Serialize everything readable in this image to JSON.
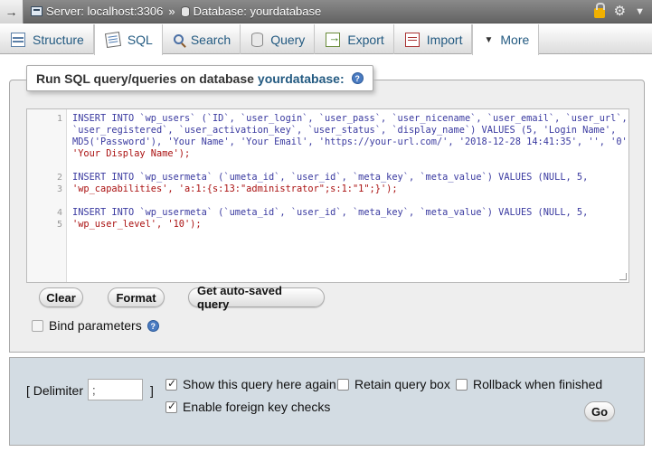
{
  "topbar": {
    "collapse_glyph": "→",
    "server_label": "Server: localhost:3306",
    "separator": "»",
    "database_label": "Database: yourdatabase"
  },
  "tabs": [
    {
      "label": "Structure",
      "icon": "structure-icon"
    },
    {
      "label": "SQL",
      "icon": "sql-icon",
      "active": true
    },
    {
      "label": "Search",
      "icon": "search-icon"
    },
    {
      "label": "Query",
      "icon": "query-icon"
    },
    {
      "label": "Export",
      "icon": "export-icon"
    },
    {
      "label": "Import",
      "icon": "import-icon"
    },
    {
      "label": "More",
      "icon": "caret-down-icon"
    }
  ],
  "legend": {
    "prefix": "Run SQL query/queries on database",
    "database": "yourdatabase:"
  },
  "editor": {
    "line_numbers": [
      "1",
      "2",
      "3",
      "4",
      "5"
    ],
    "lines": [
      "INSERT INTO `wp_users` (`ID`, `user_login`, `user_pass`, `user_nicename`, `user_email`, `user_url`,",
      "`user_registered`, `user_activation_key`, `user_status`, `display_name`) VALUES (5, 'Login Name',",
      "MD5('Password'), 'Your Name', 'Your Email', 'https://your-url.com/', '2018-12-28 14:41:35', '', '0',",
      "'Your Display Name');",
      "INSERT INTO `wp_usermeta` (`umeta_id`, `user_id`, `meta_key`, `meta_value`) VALUES (NULL, 5,",
      "'wp_capabilities', 'a:1:{s:13:\"administrator\";s:1:\"1\";}');",
      "INSERT INTO `wp_usermeta` (`umeta_id`, `user_id`, `meta_key`, `meta_value`) VALUES (NULL, 5,",
      "'wp_user_level', '10');"
    ]
  },
  "buttons": {
    "clear": "Clear",
    "format": "Format",
    "get_autosaved": "Get auto-saved query",
    "go": "Go"
  },
  "options": {
    "bind_parameters": "Bind parameters",
    "delimiter_open": "[ Delimiter",
    "delimiter_value": ";",
    "delimiter_close": "]",
    "show_query_again": "Show this query here again",
    "show_query_again_checked": true,
    "retain_query_box": "Retain query box",
    "retain_query_box_checked": false,
    "rollback_when_finished": "Rollback when finished",
    "rollback_when_finished_checked": false,
    "enable_fk_checks": "Enable foreign key checks",
    "enable_fk_checks_checked": true
  },
  "colors": {
    "link": "#235a81",
    "panel_bg": "#eeeeee",
    "footer_bg": "#d3dce3",
    "topbar_bg": "#636363"
  }
}
